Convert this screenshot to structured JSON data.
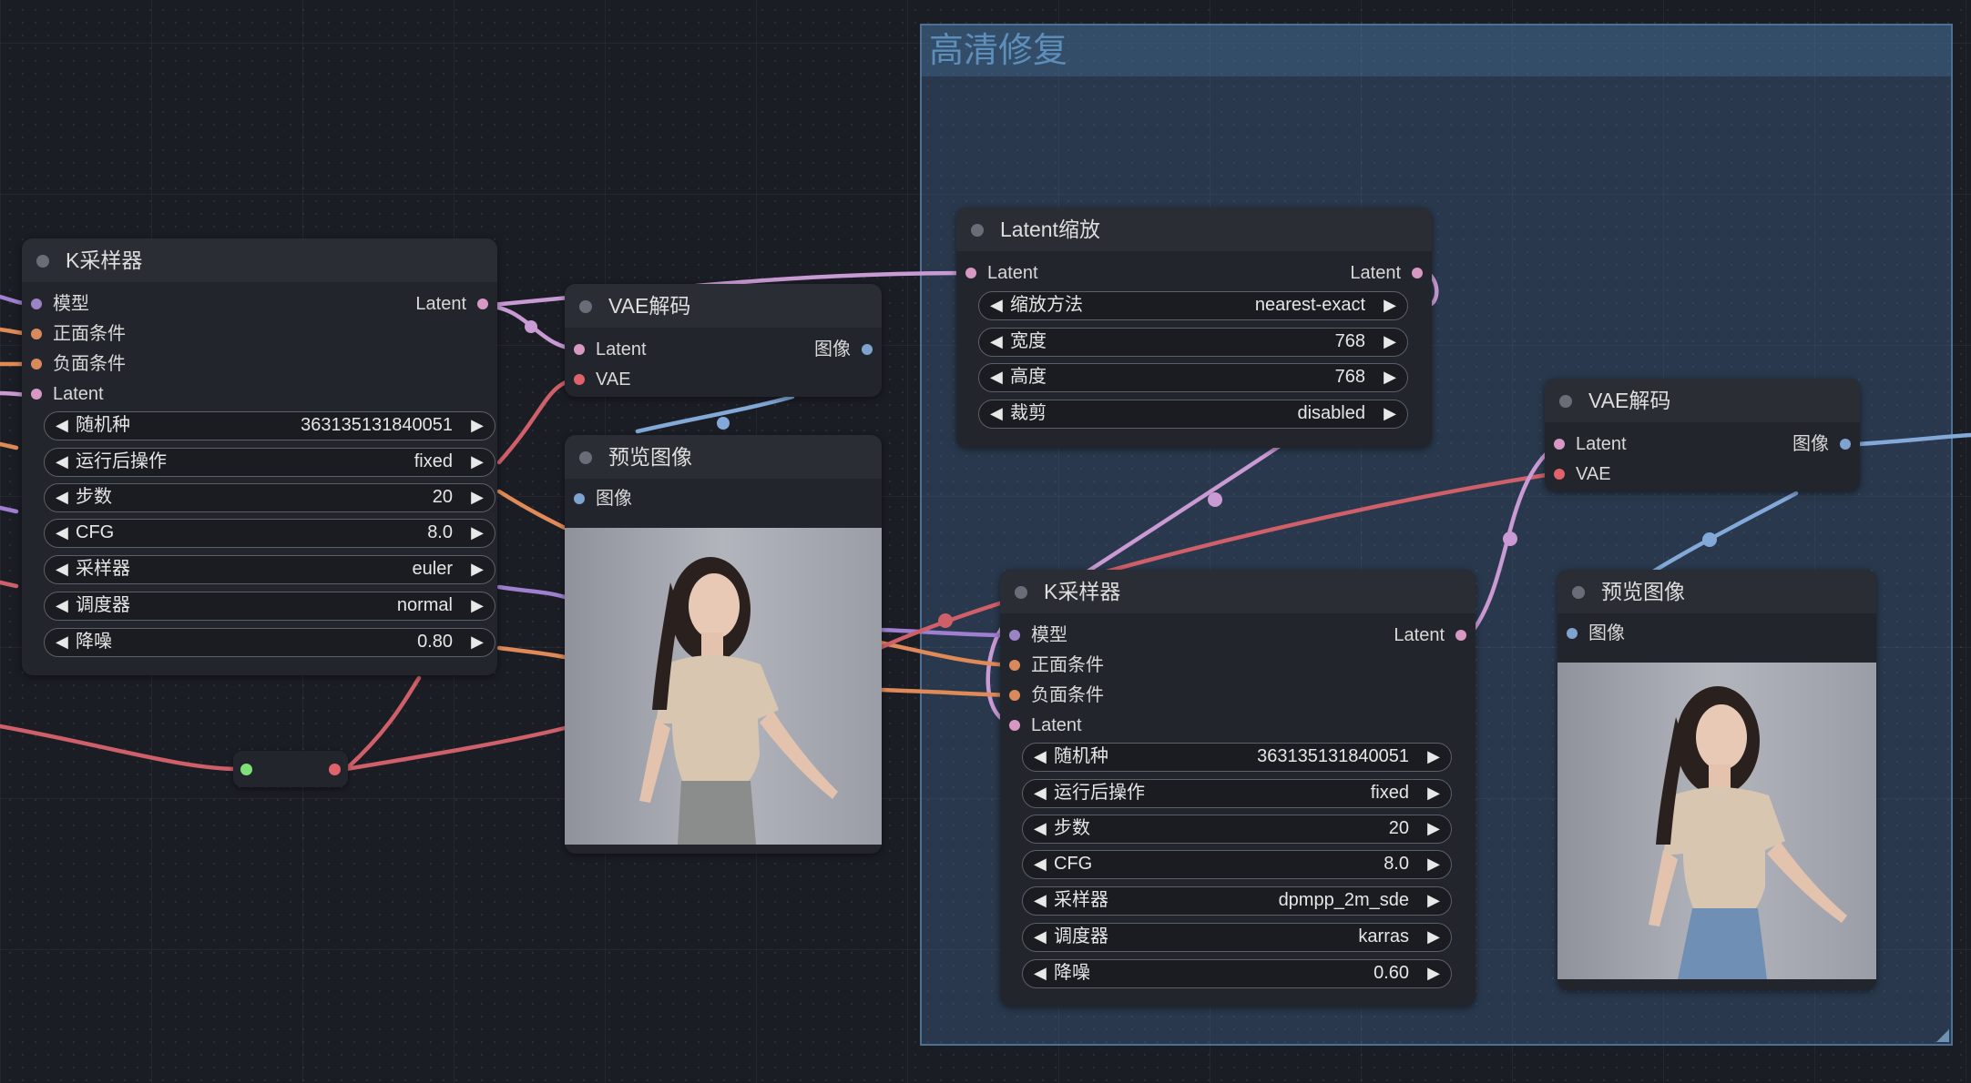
{
  "group": {
    "title": "高清修复"
  },
  "colors": {
    "model": "#9a84c4",
    "cond_pos": "#d98a5c",
    "cond_neg": "#d98a5c",
    "latent": "#d799c3",
    "image": "#7fa3d1",
    "vae": "#e0626a",
    "link_latent": "#c99ad4",
    "link_image": "#83a9d8",
    "link_vae": "#cf5f69",
    "link_cond": "#e08a57",
    "link_model": "#9f7fd0"
  },
  "ksampler1": {
    "title": "K采样器",
    "inputs": [
      "模型",
      "正面条件",
      "负面条件",
      "Latent"
    ],
    "output": "Latent",
    "widgets": [
      {
        "label": "随机种",
        "value": "363135131840051"
      },
      {
        "label": "运行后操作",
        "value": "fixed"
      },
      {
        "label": "步数",
        "value": "20"
      },
      {
        "label": "CFG",
        "value": "8.0"
      },
      {
        "label": "采样器",
        "value": "euler"
      },
      {
        "label": "调度器",
        "value": "normal"
      },
      {
        "label": "降噪",
        "value": "0.80"
      }
    ]
  },
  "vae_decode1": {
    "title": "VAE解码",
    "inputs": [
      "Latent",
      "VAE"
    ],
    "output": "图像"
  },
  "preview1": {
    "title": "预览图像",
    "input": "图像"
  },
  "latent_upscale": {
    "title": "Latent缩放",
    "input": "Latent",
    "output": "Latent",
    "widgets": [
      {
        "label": "缩放方法",
        "value": "nearest-exact"
      },
      {
        "label": "宽度",
        "value": "768"
      },
      {
        "label": "高度",
        "value": "768"
      },
      {
        "label": "裁剪",
        "value": "disabled"
      }
    ]
  },
  "ksampler2": {
    "title": "K采样器",
    "inputs": [
      "模型",
      "正面条件",
      "负面条件",
      "Latent"
    ],
    "output": "Latent",
    "widgets": [
      {
        "label": "随机种",
        "value": "363135131840051"
      },
      {
        "label": "运行后操作",
        "value": "fixed"
      },
      {
        "label": "步数",
        "value": "20"
      },
      {
        "label": "CFG",
        "value": "8.0"
      },
      {
        "label": "采样器",
        "value": "dpmpp_2m_sde"
      },
      {
        "label": "调度器",
        "value": "karras"
      },
      {
        "label": "降噪",
        "value": "0.60"
      }
    ]
  },
  "vae_decode2": {
    "title": "VAE解码",
    "inputs": [
      "Latent",
      "VAE"
    ],
    "output": "图像"
  },
  "preview2": {
    "title": "预览图像",
    "input": "图像"
  },
  "arrows": {
    "left": "◀",
    "right": "▶"
  }
}
